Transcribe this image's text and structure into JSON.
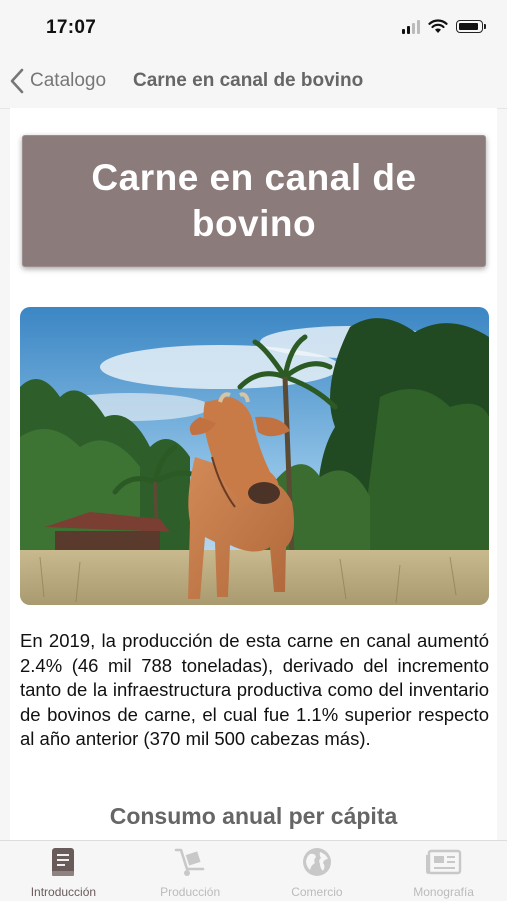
{
  "status_bar": {
    "time": "17:07"
  },
  "nav": {
    "back_label": "Catalogo",
    "title": "Carne en canal de bovino"
  },
  "header_card": {
    "title": "Carne en canal de bovino"
  },
  "photo": {
    "alt": "Toro joven de color café en un campo con palmeras"
  },
  "body": {
    "paragraph": "En 2019, la producción de esta carne en canal aumentó 2.4% (46 mil 788 toneladas), derivado del incremento tanto de la infraestructura productiva como del inventario de bovinos de carne, el cual fue 1.1% superior respecto al año anterior (370 mil 500 cabezas más)."
  },
  "section": {
    "heading": "Consumo anual per cápita"
  },
  "tabs": [
    {
      "label": "Introducción",
      "icon": "book-icon",
      "active": true
    },
    {
      "label": "Producción",
      "icon": "hand-truck-icon",
      "active": false
    },
    {
      "label": "Comercio",
      "icon": "globe-icon",
      "active": false
    },
    {
      "label": "Monografía",
      "icon": "newspaper-icon",
      "active": false
    }
  ],
  "colors": {
    "accent": "#8b7b7b",
    "active_tab": "#6a5b5b",
    "inactive_tab": "#bbbbbb"
  }
}
